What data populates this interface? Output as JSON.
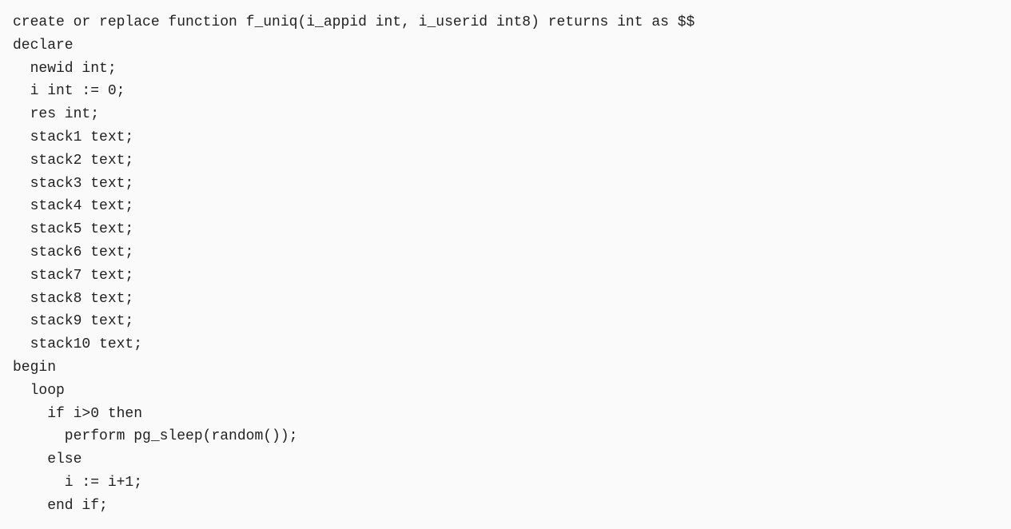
{
  "code": {
    "lines": [
      "create or replace function f_uniq(i_appid int, i_userid int8) returns int as $$",
      "declare",
      "  newid int;",
      "  i int := 0;",
      "  res int;",
      "  stack1 text;",
      "  stack2 text;",
      "  stack3 text;",
      "  stack4 text;",
      "  stack5 text;",
      "  stack6 text;",
      "  stack7 text;",
      "  stack8 text;",
      "  stack9 text;",
      "  stack10 text;",
      "begin",
      "  loop",
      "    if i>0 then",
      "      perform pg_sleep(random());",
      "    else",
      "      i := i+1;",
      "    end if;"
    ]
  }
}
